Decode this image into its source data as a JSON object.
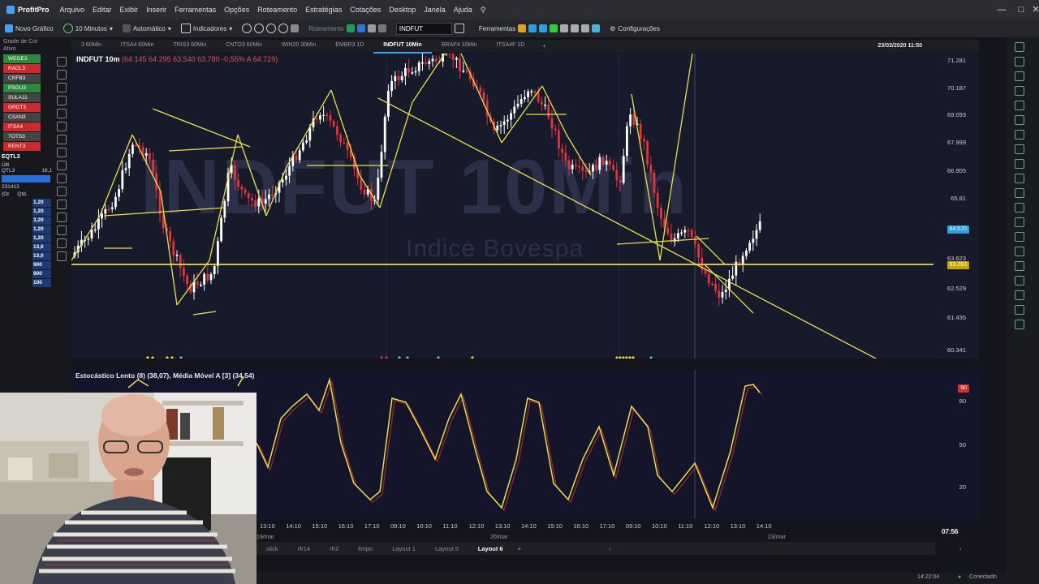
{
  "app": {
    "name": "ProfitPro"
  },
  "menu": [
    "Arquivo",
    "Editar",
    "Exibir",
    "Inserir",
    "Ferramentas",
    "Opções",
    "Roteamento",
    "Estratégias",
    "Cotações",
    "Desktop",
    "Janela",
    "Ajuda"
  ],
  "toolbar": {
    "new_chart": "Novo Gráfico",
    "interval": "10 Minutos",
    "mode": "Automático",
    "indicators": "Indicadores",
    "routing": "Roteamento",
    "symbol": "INDFUT",
    "tools": "Ferramentas",
    "settings": "Configurações"
  },
  "left_panel": {
    "header": "Grade de Cot",
    "col_asset": "Ativo",
    "assets": [
      "WEGE3",
      "RADL3",
      "CRFB3",
      "PSGU3",
      "SULA11",
      "GRDT3",
      "CSAN3",
      "ITSA4",
      "TOTS3",
      "RENT3"
    ],
    "ticker": "EQTL3",
    "col_ult": "Últi",
    "qtl": "QTL3",
    "qtl_val": "16,1",
    "val1": "231412",
    "ord": "(Or",
    "qtd": "Qtd.",
    "book_vals": [
      "1,20",
      "1,20",
      "3,20",
      "1,20",
      "1,20",
      "13,0",
      "13,0",
      "900",
      "900",
      "100"
    ]
  },
  "tabs": [
    {
      "label": "3 60Min",
      "active": false
    },
    {
      "label": "ITSA4 60Min",
      "active": false
    },
    {
      "label": "TRIS3 60Min",
      "active": false
    },
    {
      "label": "CNTO3 60Min",
      "active": false
    },
    {
      "label": "WIN20 30Min",
      "active": false
    },
    {
      "label": "EMBR3 1D",
      "active": false
    },
    {
      "label": "INDFUT 10Min",
      "active": true
    },
    {
      "label": "BRAP4 10Min",
      "active": false
    },
    {
      "label": "ITSA4F 1D",
      "active": false
    }
  ],
  "datetime": "23/03/2020 11:50",
  "chart": {
    "symbol_label": "INDFUT 10m",
    "quote": "(64.145  64.295  63.540  63.780  -0,55%  A 64.729)",
    "watermark": "INDFUT 10Min",
    "watermark_sub": "Indice Bovespa",
    "price_labels": [
      "71.281",
      "70.187",
      "69.093",
      "67.999",
      "66.905",
      "65.81",
      "63.623",
      "62.529",
      "61.435",
      "60.341"
    ],
    "tag_current": "64.570",
    "tag_support": "63.263",
    "support_level": 63263
  },
  "oscillator": {
    "label": "Estocástico Lento (8) (38,07), Média Móvel A [3] (34,54)",
    "levels": [
      "80",
      "50",
      "20"
    ],
    "tag": "90"
  },
  "xaxis": {
    "times": [
      "13:10",
      "14:10",
      "15:10",
      "16:10",
      "17:10",
      "09:10",
      "10:10",
      "11:10",
      "12:10",
      "13:10",
      "14:10",
      "15:10",
      "16:10",
      "17:10",
      "09:10",
      "10:10",
      "11:10",
      "12:10",
      "13:10",
      "14:10"
    ],
    "dates": [
      "19/mar",
      "20/mar",
      "23/mar"
    ]
  },
  "layouts": [
    {
      "label": "slick",
      "active": false
    },
    {
      "label": "rfr14",
      "active": false
    },
    {
      "label": "rfr2",
      "active": false
    },
    {
      "label": "limpo",
      "active": false
    },
    {
      "label": "Layout 1",
      "active": false
    },
    {
      "label": "Layout 5",
      "active": false
    },
    {
      "label": "Layout 6",
      "active": true
    }
  ],
  "clock": "07:56",
  "status": {
    "time": "14:22:04",
    "connection": "Conectado"
  },
  "colors": {
    "bull": "#ffffff",
    "bear": "#e0353a",
    "lines": "#e9e04a",
    "accent": "#3fa2f7"
  }
}
